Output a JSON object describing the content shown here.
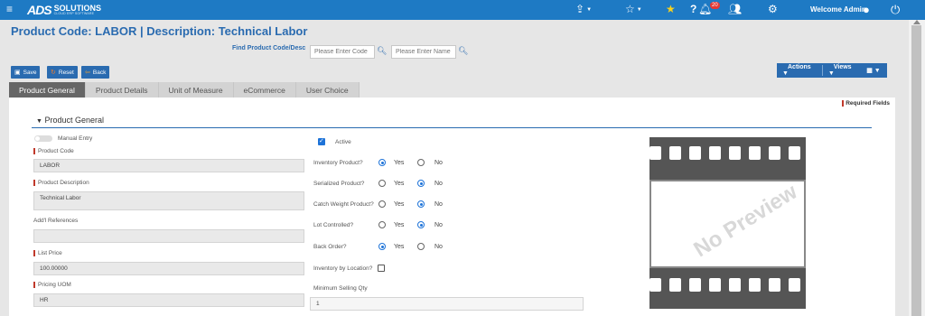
{
  "topbar": {
    "logo_ads": "ADS",
    "logo_solutions": "SOLUTIONS",
    "logo_tagline": "CLOUD ERP SOFTWARE",
    "notification_count": "20",
    "welcome": "Welcome Admin"
  },
  "header": {
    "title": "Product Code:  LABOR | Description: Technical Labor",
    "find_label": "Find Product Code/Desc",
    "code_placeholder": "Please Enter Code",
    "name_placeholder": "Please Enter Name"
  },
  "toolbar": {
    "save": "Save",
    "reset": "Reset",
    "back": "Back",
    "actions": "Actions",
    "views": "Views"
  },
  "tabs": [
    "Product General",
    "Product Details",
    "Unit of Measure",
    "eCommerce",
    "User Choice"
  ],
  "panel": {
    "required_fields": "Required Fields",
    "section_title": "Product General",
    "manual_entry": "Manual Entry",
    "product_code_label": "Product Code",
    "product_code_value": "LABOR",
    "product_description_label": "Product Description",
    "product_description_value": "Technical Labor",
    "addl_references_label": "Add'l References",
    "addl_references_value": "",
    "list_price_label": "List Price",
    "list_price_value": "100.00000",
    "pricing_uom_label": "Pricing UOM",
    "pricing_uom_value": "HR",
    "active_label": "Active",
    "inventory_product_label": "Inventory Product?",
    "serialized_product_label": "Serialized Product?",
    "catch_weight_label": "Catch Weight Product?",
    "lot_controlled_label": "Lot Controlled?",
    "back_order_label": "Back Order?",
    "inventory_by_location_label": "Inventory by Location?",
    "min_selling_qty_label": "Minimum Selling Qty",
    "min_selling_qty_value": "1",
    "yes": "Yes",
    "no": "No",
    "no_preview": "No Preview"
  },
  "colors": {
    "topbar": "#1e7ac4",
    "accent": "#2a6bb0",
    "required": "#c0392b"
  }
}
